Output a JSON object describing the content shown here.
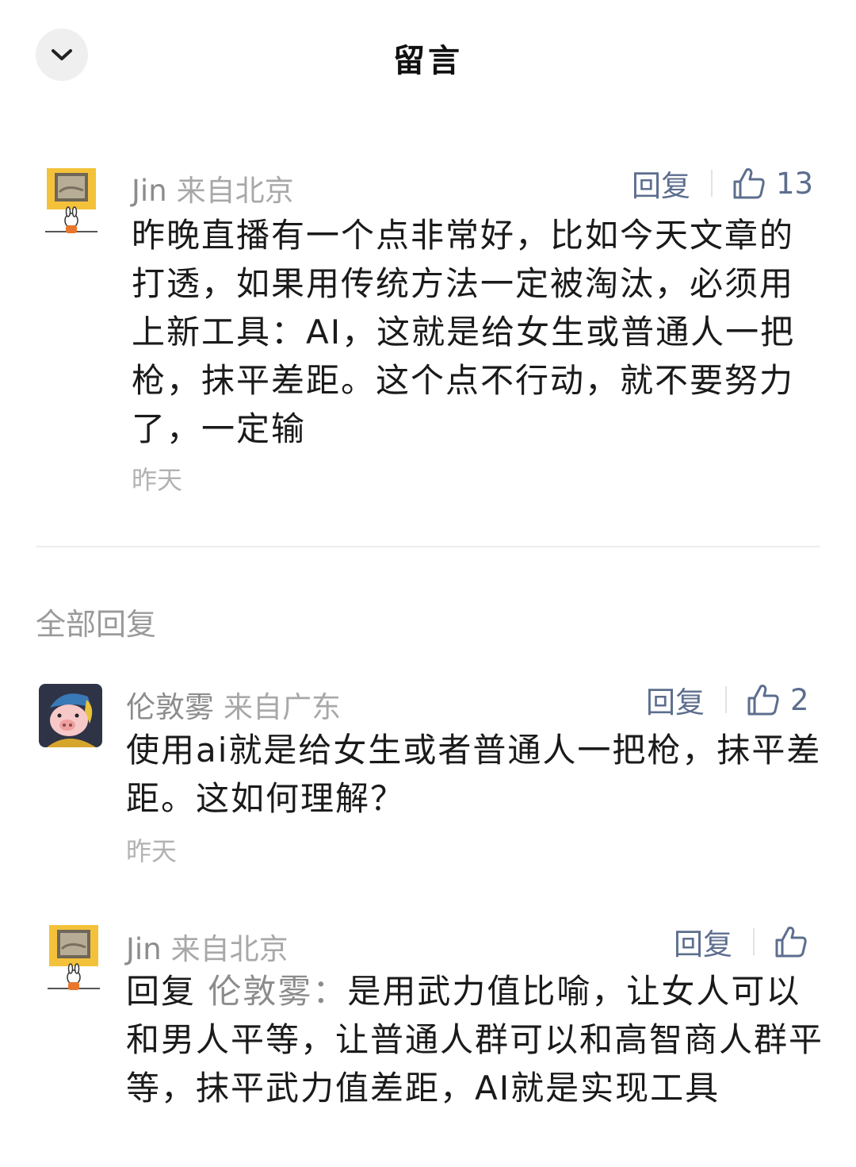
{
  "header": {
    "title": "留言",
    "back_icon": "chevron-down-icon"
  },
  "main_comment": {
    "author": "Jin",
    "location": "来自北京",
    "reply_label": "回复",
    "like_count": "13",
    "body": "昨晚直播有一个点非常好，比如今天文章的打透，如果用传统方法一定被淘汰，必须用上新工具：AI，这就是给女生或普通人一把枪，抹平差距。这个点不行动，就不要努力了，一定输",
    "time": "昨天"
  },
  "replies_section": {
    "title": "全部回复"
  },
  "replies": [
    {
      "author": "伦敦雾",
      "location": "来自广东",
      "reply_label": "回复",
      "like_count": "2",
      "body": "使用ai就是给女生或者普通人一把枪，抹平差距。这如何理解？",
      "time": "昨天"
    },
    {
      "author": "Jin",
      "location": "来自北京",
      "reply_label": "回复",
      "like_count": "",
      "reply_prefix": "回复",
      "mention": "伦敦雾：",
      "body": "是用武力值比喻，让女人可以和男人平等，让普通人群可以和高智商人群平等，抹平武力值差距，AI就是实现工具"
    }
  ],
  "colors": {
    "link_blue_gray": "#5d6e8e",
    "meta_gray": "#8c8c8c",
    "time_gray": "#b2b2b2",
    "divider": "#ececec"
  }
}
